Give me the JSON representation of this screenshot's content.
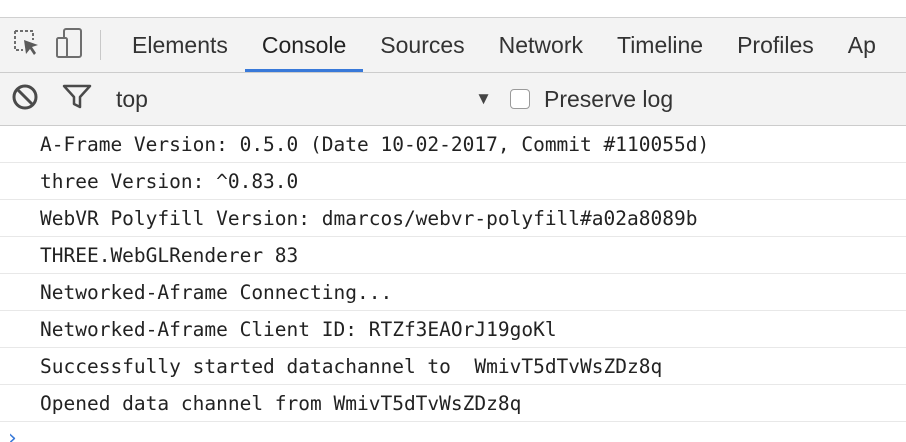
{
  "toolbar": {
    "inspect_icon": "inspect-element-icon",
    "device_icon": "device-mode-icon"
  },
  "tabs": [
    {
      "label": "Elements"
    },
    {
      "label": "Console"
    },
    {
      "label": "Sources"
    },
    {
      "label": "Network"
    },
    {
      "label": "Timeline"
    },
    {
      "label": "Profiles"
    },
    {
      "label": "Ap"
    }
  ],
  "active_tab": "Console",
  "filterbar": {
    "context": "top",
    "preserve_log_label": "Preserve log",
    "preserve_log_checked": false
  },
  "console": {
    "lines": [
      "A-Frame Version: 0.5.0 (Date 10-02-2017, Commit #110055d)",
      "three Version: ^0.83.0",
      "WebVR Polyfill Version: dmarcos/webvr-polyfill#a02a8089b",
      "THREE.WebGLRenderer 83",
      "Networked-Aframe Connecting...",
      "Networked-Aframe Client ID: RTZf3EAOrJ19goKl",
      "Successfully started datachannel to  WmivT5dTvWsZDz8q",
      "Opened data channel from WmivT5dTvWsZDz8q"
    ],
    "prompt_symbol": "›"
  },
  "colors": {
    "accent": "#3879d9",
    "toolbar_bg": "#f3f3f3"
  }
}
